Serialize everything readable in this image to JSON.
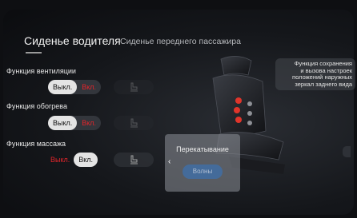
{
  "tabs": {
    "active_label": "Сиденье водителя",
    "inactive_label": "Сиденье переднего пассажира"
  },
  "ventilation": {
    "label": "Функция вентиляции",
    "off_label": "Выкл.",
    "on_label": "Вкл.",
    "selected": "off"
  },
  "heating": {
    "label": "Функция обогрева",
    "off_label": "Выкл.",
    "on_label": "Вкл.",
    "selected": "off"
  },
  "massage": {
    "label": "Функция массажа",
    "off_label": "Выкл.",
    "on_label": "Вкл.",
    "selected": "on"
  },
  "mirror_info": {
    "line1": "Функция сохранения",
    "line2": "и вызова настроек",
    "line3": "положений наружных",
    "line4": "зеркал заднего вида"
  },
  "massage_popup": {
    "title": "Перекатывание",
    "button_label": "Волны"
  },
  "colors": {
    "accent_red": "#e0252b",
    "selected_pill": "#e4e4e4",
    "popup_button_blue": "#3f6fa8",
    "seat_dot_red": "#e0352b"
  },
  "icons": {
    "seat_button_icon": "seat-icon",
    "popup_arrow": "chevron-left-icon"
  }
}
